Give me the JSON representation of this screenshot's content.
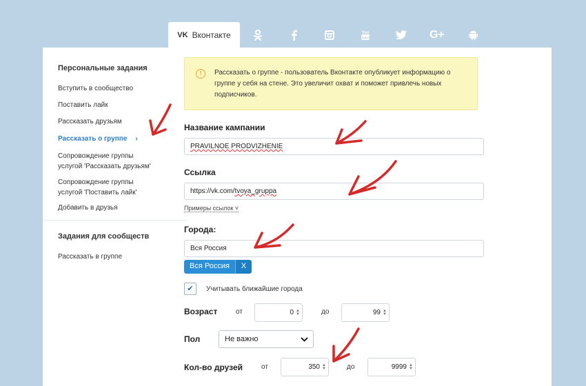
{
  "tabs": {
    "active_label": "Вконтакте",
    "active_logo": "VK",
    "icons": [
      "odnoklassniki-icon",
      "facebook-icon",
      "instagram-icon",
      "youtube-icon",
      "twitter-icon",
      "google-plus-icon",
      "android-icon"
    ]
  },
  "sidebar": {
    "heading_personal": "Персональные задания",
    "items": [
      "Вступить в сообщество",
      "Поставить лайк",
      "Рассказать друзьям",
      "Рассказать о группе",
      "Сопровождение группы",
      "услугой 'Рассказать друзьям'",
      "Сопровождение группы",
      "услугой 'Поставить лайк'",
      "Добавить в друзья"
    ],
    "heading_community": "Задания для сообществ",
    "community_items": [
      "Рассказать в группе"
    ],
    "active_chevron": "›"
  },
  "notice": {
    "icon": "!",
    "text": "Рассказать о группе - пользователь Вконтакте опубликует информацию о группе у себя на стене. Это увеличит охват и поможет привлечь новых подписчиков."
  },
  "form": {
    "campaign_label": "Название кампании",
    "campaign_value": "PRAVILNOE PRODVIZHENIE",
    "link_label": "Ссылка",
    "link_value_prefix": "https://vk.com/",
    "link_value_slug": "tvoya_gruppa",
    "examples_label": "Примеры ссылок ˅",
    "cities_label": "Города:",
    "cities_value": "Вся Россия",
    "city_tag": "Вся Россия",
    "city_tag_close": "X",
    "nearby_checked": "✔",
    "nearby_label": "Учитывать ближайшие города",
    "age_label": "Возраст",
    "from_label": "от",
    "to_label": "до",
    "age_from": "0",
    "age_to": "99",
    "sex_label": "Пол",
    "sex_value": "Не важно",
    "friends_label": "Кол-во друзей",
    "friends_from": "350",
    "friends_to": "9999"
  },
  "colors": {
    "background": "#bcd3e6",
    "accent": "#2a8fd6",
    "notice_bg": "#fbf7c0",
    "annotation_arrow": "#d42a2a"
  }
}
